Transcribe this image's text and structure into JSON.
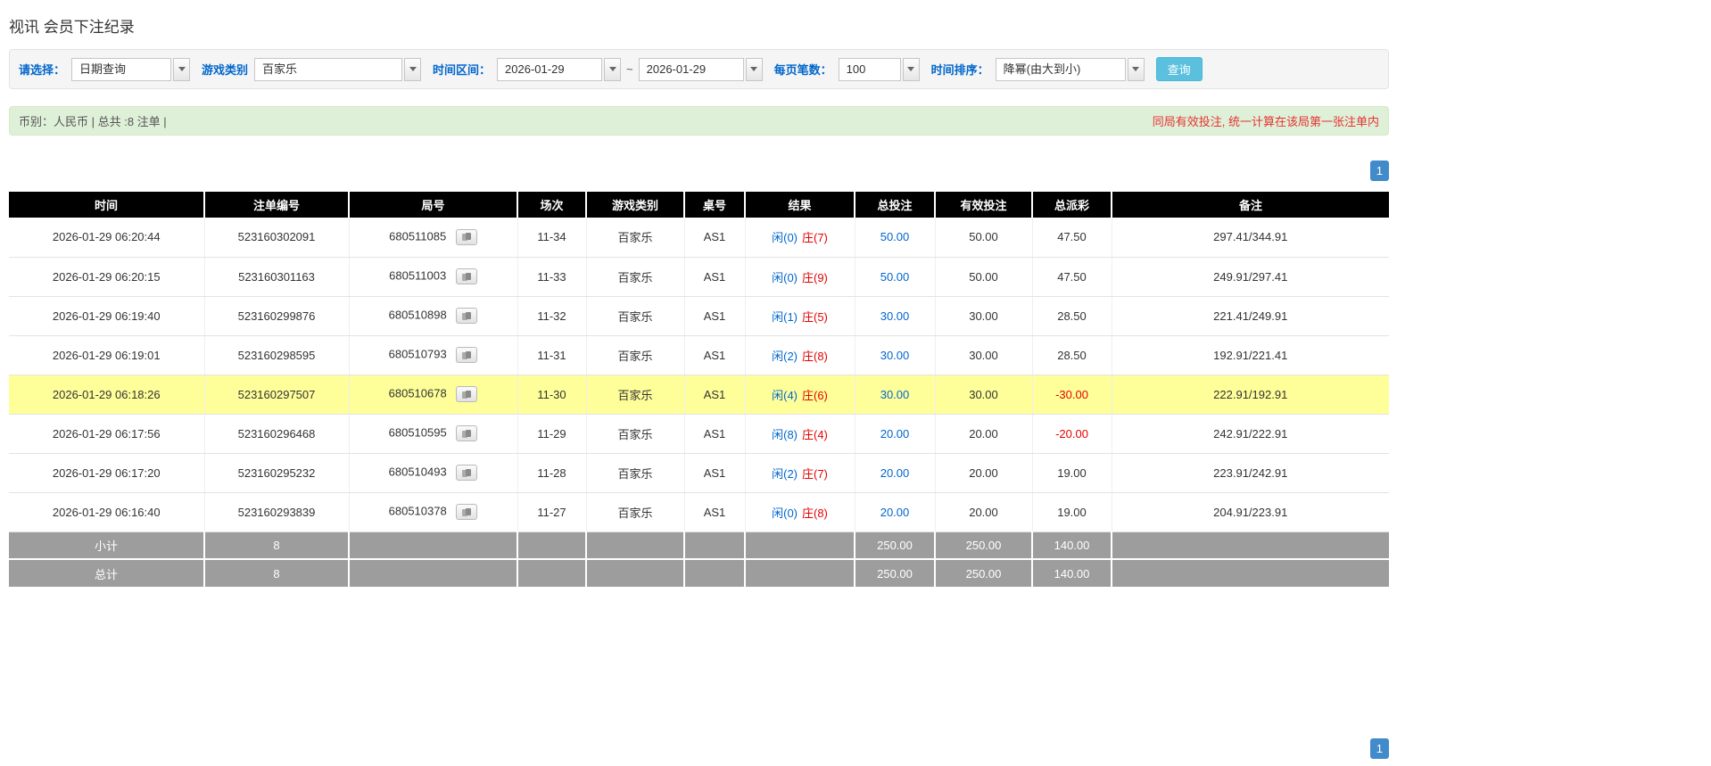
{
  "title": "视讯 会员下注纪录",
  "filters": {
    "select_label": "请选择：",
    "select_value": "日期查询",
    "game_label": "游戏类别",
    "game_value": "百家乐",
    "range_label": "时间区间：",
    "range_from": "2026-01-29",
    "range_separator": "~",
    "range_to": "2026-01-29",
    "per_page_label": "每页笔数：",
    "per_page_value": "100",
    "sort_label": "时间排序：",
    "sort_value": "降幂(由大到小)",
    "query_button": "查询"
  },
  "info": {
    "summary": "币别：人民币 | 总共 :8 注单 |",
    "notice": "同局有效投注, 统一计算在该局第一张注单内"
  },
  "pagination": {
    "page": "1"
  },
  "table": {
    "headers": [
      "时间",
      "注单编号",
      "局号",
      "场次",
      "游戏类别",
      "桌号",
      "结果",
      "总投注",
      "有效投注",
      "总派彩",
      "备注"
    ],
    "rows": [
      {
        "time": "2026-01-29 06:20:44",
        "bet_id": "523160302091",
        "round": "680511085",
        "session": "11-34",
        "game": "百家乐",
        "table_no": "AS1",
        "result_player": "闲(0)",
        "result_banker": "庄(7)",
        "total_bet": "50.00",
        "valid_bet": "50.00",
        "payout": "47.50",
        "remark": "297.41/344.91"
      },
      {
        "time": "2026-01-29 06:20:15",
        "bet_id": "523160301163",
        "round": "680511003",
        "session": "11-33",
        "game": "百家乐",
        "table_no": "AS1",
        "result_player": "闲(0)",
        "result_banker": "庄(9)",
        "total_bet": "50.00",
        "valid_bet": "50.00",
        "payout": "47.50",
        "remark": "249.91/297.41"
      },
      {
        "time": "2026-01-29 06:19:40",
        "bet_id": "523160299876",
        "round": "680510898",
        "session": "11-32",
        "game": "百家乐",
        "table_no": "AS1",
        "result_player": "闲(1)",
        "result_banker": "庄(5)",
        "total_bet": "30.00",
        "valid_bet": "30.00",
        "payout": "28.50",
        "remark": "221.41/249.91"
      },
      {
        "time": "2026-01-29 06:19:01",
        "bet_id": "523160298595",
        "round": "680510793",
        "session": "11-31",
        "game": "百家乐",
        "table_no": "AS1",
        "result_player": "闲(2)",
        "result_banker": "庄(8)",
        "total_bet": "30.00",
        "valid_bet": "30.00",
        "payout": "28.50",
        "remark": "192.91/221.41"
      },
      {
        "time": "2026-01-29 06:18:26",
        "bet_id": "523160297507",
        "round": "680510678",
        "session": "11-30",
        "game": "百家乐",
        "table_no": "AS1",
        "result_player": "闲(4)",
        "result_banker": "庄(6)",
        "total_bet": "30.00",
        "valid_bet": "30.00",
        "payout": "-30.00",
        "remark": "222.91/192.91",
        "highlighted": true
      },
      {
        "time": "2026-01-29 06:17:56",
        "bet_id": "523160296468",
        "round": "680510595",
        "session": "11-29",
        "game": "百家乐",
        "table_no": "AS1",
        "result_player": "闲(8)",
        "result_banker": "庄(4)",
        "total_bet": "20.00",
        "valid_bet": "20.00",
        "payout": "-20.00",
        "remark": "242.91/222.91"
      },
      {
        "time": "2026-01-29 06:17:20",
        "bet_id": "523160295232",
        "round": "680510493",
        "session": "11-28",
        "game": "百家乐",
        "table_no": "AS1",
        "result_player": "闲(2)",
        "result_banker": "庄(7)",
        "total_bet": "20.00",
        "valid_bet": "20.00",
        "payout": "19.00",
        "remark": "223.91/242.91"
      },
      {
        "time": "2026-01-29 06:16:40",
        "bet_id": "523160293839",
        "round": "680510378",
        "session": "11-27",
        "game": "百家乐",
        "table_no": "AS1",
        "result_player": "闲(0)",
        "result_banker": "庄(8)",
        "total_bet": "20.00",
        "valid_bet": "20.00",
        "payout": "19.00",
        "remark": "204.91/223.91"
      }
    ],
    "footer": {
      "subtotal_label": "小计",
      "total_label": "总计",
      "count": "8",
      "total_bet": "250.00",
      "valid_bet": "250.00",
      "payout": "140.00"
    }
  },
  "colors": {
    "accent_blue": "#428bca",
    "player_blue": "#0066cc",
    "banker_red": "#e60000",
    "highlight_yellow": "#ffff99",
    "header_black": "#000000",
    "footer_gray": "#9d9d9d"
  }
}
